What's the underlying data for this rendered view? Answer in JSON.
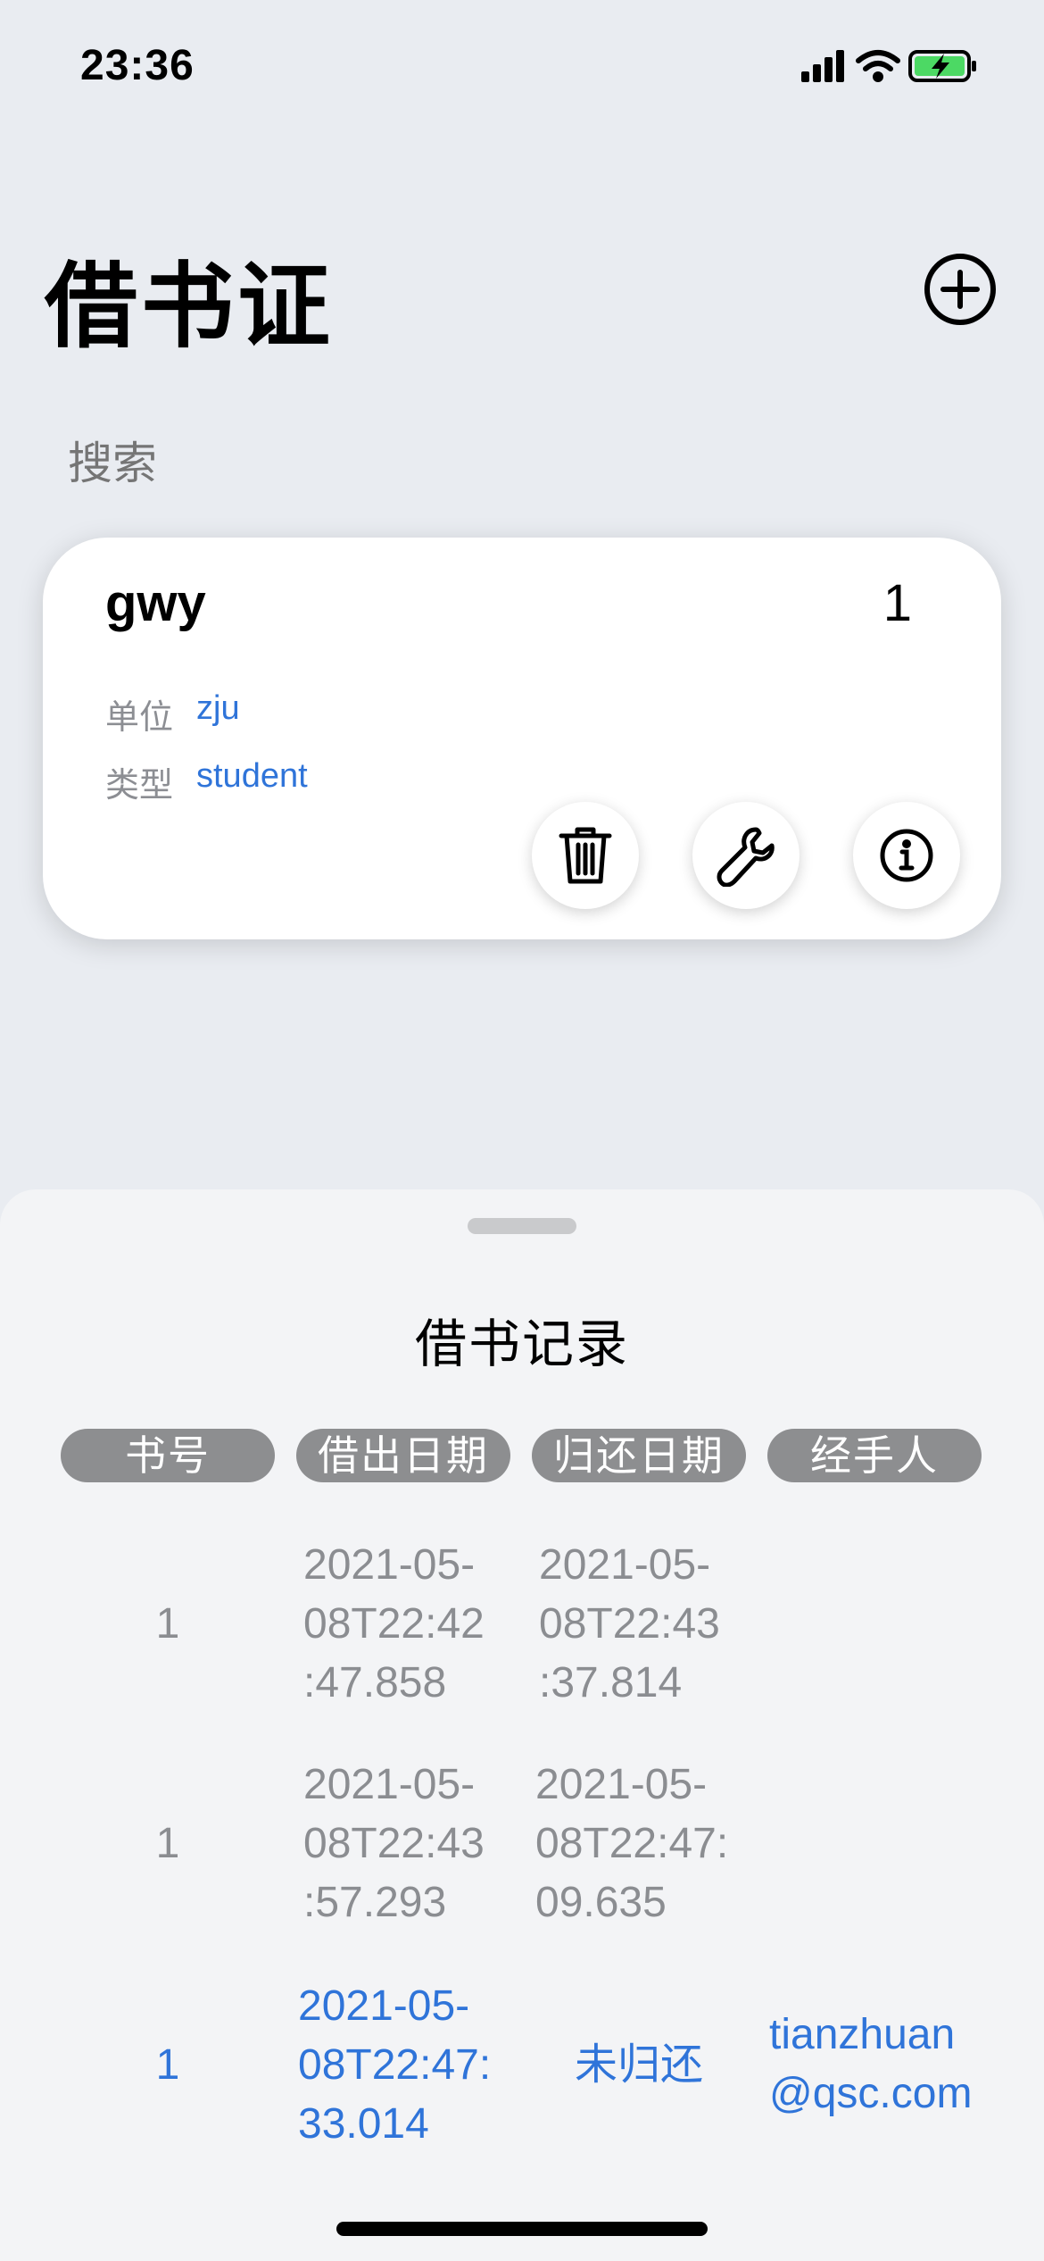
{
  "status_bar": {
    "time": "23:36",
    "icons": [
      "signal-icon",
      "wifi-icon",
      "battery-charging-icon"
    ]
  },
  "header": {
    "title": "借书证",
    "add_icon": "plus-circle-icon"
  },
  "search": {
    "placeholder": "搜索"
  },
  "card": {
    "name": "gwy",
    "count": "1",
    "unit_label": "单位",
    "unit_value": "zju",
    "type_label": "类型",
    "type_value": "student",
    "actions": [
      "trash-icon",
      "wrench-icon",
      "info-icon"
    ]
  },
  "sheet": {
    "title": "借书记录",
    "headers": [
      "书号",
      "借出日期",
      "归还日期",
      "经手人"
    ],
    "rows": [
      {
        "book_no": "1",
        "borrow_date": "2021-05-\n08T22:42\n:47.858",
        "return_date": "2021-05-\n08T22:43\n:37.814",
        "handler": ""
      },
      {
        "book_no": "1",
        "borrow_date": "2021-05-\n08T22:43\n:57.293",
        "return_date": "2021-05-\n08T22:47:\n09.635",
        "handler": ""
      },
      {
        "book_no": "1",
        "borrow_date": "2021-05-\n08T22:47:\n33.014",
        "return_date": "未归还",
        "handler": "tianzhuan\n@qsc.com"
      }
    ]
  },
  "colors": {
    "accent": "#2f74d9",
    "muted_text": "#8b8d91",
    "header_pill": "#8d8e90",
    "background": "#e9ecf1"
  }
}
